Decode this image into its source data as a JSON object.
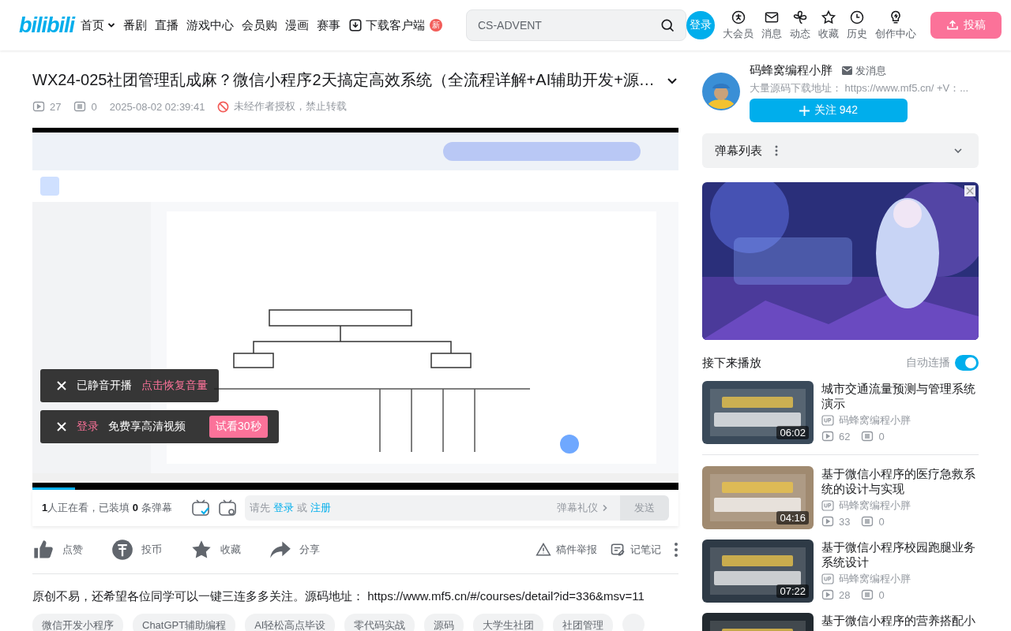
{
  "header": {
    "logo": "bilibili",
    "nav": [
      {
        "label": "首页",
        "kind": "dropdown"
      },
      {
        "label": "番剧",
        "kind": "plain"
      },
      {
        "label": "直播",
        "kind": "plain"
      },
      {
        "label": "游戏中心",
        "kind": "plain"
      },
      {
        "label": "会员购",
        "kind": "plain"
      },
      {
        "label": "漫画",
        "kind": "plain"
      },
      {
        "label": "赛事",
        "kind": "plain"
      },
      {
        "label": "下载客户端",
        "kind": "download",
        "badge": "新"
      }
    ],
    "search": {
      "placeholder": "CS-ADVENT"
    },
    "login": "登录",
    "icons": [
      {
        "label": "大会员",
        "kind": "vip"
      },
      {
        "label": "消息",
        "kind": "mail"
      },
      {
        "label": "动态",
        "kind": "fan"
      },
      {
        "label": "收藏",
        "kind": "star"
      },
      {
        "label": "历史",
        "kind": "clock"
      },
      {
        "label": "创作中心",
        "kind": "bulb"
      }
    ],
    "upload": "投稿"
  },
  "video": {
    "title": "WX24-025社团管理乱成麻？微信小程序2天搞定高效系统（全流程详解+AI辅助开发+源…",
    "views": "27",
    "danmaku": "0",
    "date": "2025-08-02 02:39:41",
    "notice": "未经作者授权，禁止转载"
  },
  "player": {
    "progress": {
      "level": 0.066
    },
    "toasts": [
      {
        "kind": "muted",
        "text": "已静音开播",
        "action": "点击恢复音量"
      },
      {
        "kind": "login",
        "link": "登录",
        "text": "免费享高清视频",
        "button": "试看30秒"
      }
    ]
  },
  "danmaku_bar": {
    "status": "**1**人正在看，已装填 **0** 条弹幕",
    "prompt": "请先",
    "login": "登录",
    "or": "或",
    "register": "注册",
    "etiquette": "弹幕礼仪",
    "send": "发送"
  },
  "actions": [
    {
      "label": "点赞",
      "kind": "like"
    },
    {
      "label": "投币",
      "kind": "coin"
    },
    {
      "label": "收藏",
      "kind": "star"
    },
    {
      "label": "分享",
      "kind": "share"
    }
  ],
  "tools": [
    {
      "label": "稿件举报",
      "kind": "report"
    },
    {
      "label": "记笔记",
      "kind": "note"
    }
  ],
  "description": "原创不易，还希望各位同学可以一键三连多多关注。源码地址： https://www.mf5.cn/#/courses/detail?id=336&msv=11",
  "tags": [
    "微信开发小程序",
    "ChatGPT辅助编程",
    "AI轻松高点毕设",
    "零代码实战",
    "源码",
    "大学生社团",
    "社团管理"
  ],
  "uploader": {
    "name": "码蜂窝编程小胖",
    "message": "发消息",
    "bio": "大量源码下载地址： https://www.mf5.cn/ +V：...",
    "follow": "关注 942"
  },
  "danmaku_list": {
    "title": "弹幕列表"
  },
  "next": {
    "title": "接下来播放",
    "autoplay": {
      "label": "自动连播",
      "on": true
    }
  },
  "recommendations": [
    {
      "title": "城市交通流量预测与管理系统演示",
      "author": "码蜂窝编程小胖",
      "views": "62",
      "danmaku": "0",
      "duration": "06:02"
    },
    {
      "title": "基于微信小程序的医疗急救系统的设计与实现",
      "author": "码蜂窝编程小胖",
      "views": "33",
      "danmaku": "0",
      "duration": "04:16"
    },
    {
      "title": "基于微信小程序校园跑腿业务系统设计",
      "author": "码蜂窝编程小胖",
      "views": "28",
      "danmaku": "0",
      "duration": "07:22"
    },
    {
      "title": "基于微信小程序的营养搭配小"
    }
  ]
}
